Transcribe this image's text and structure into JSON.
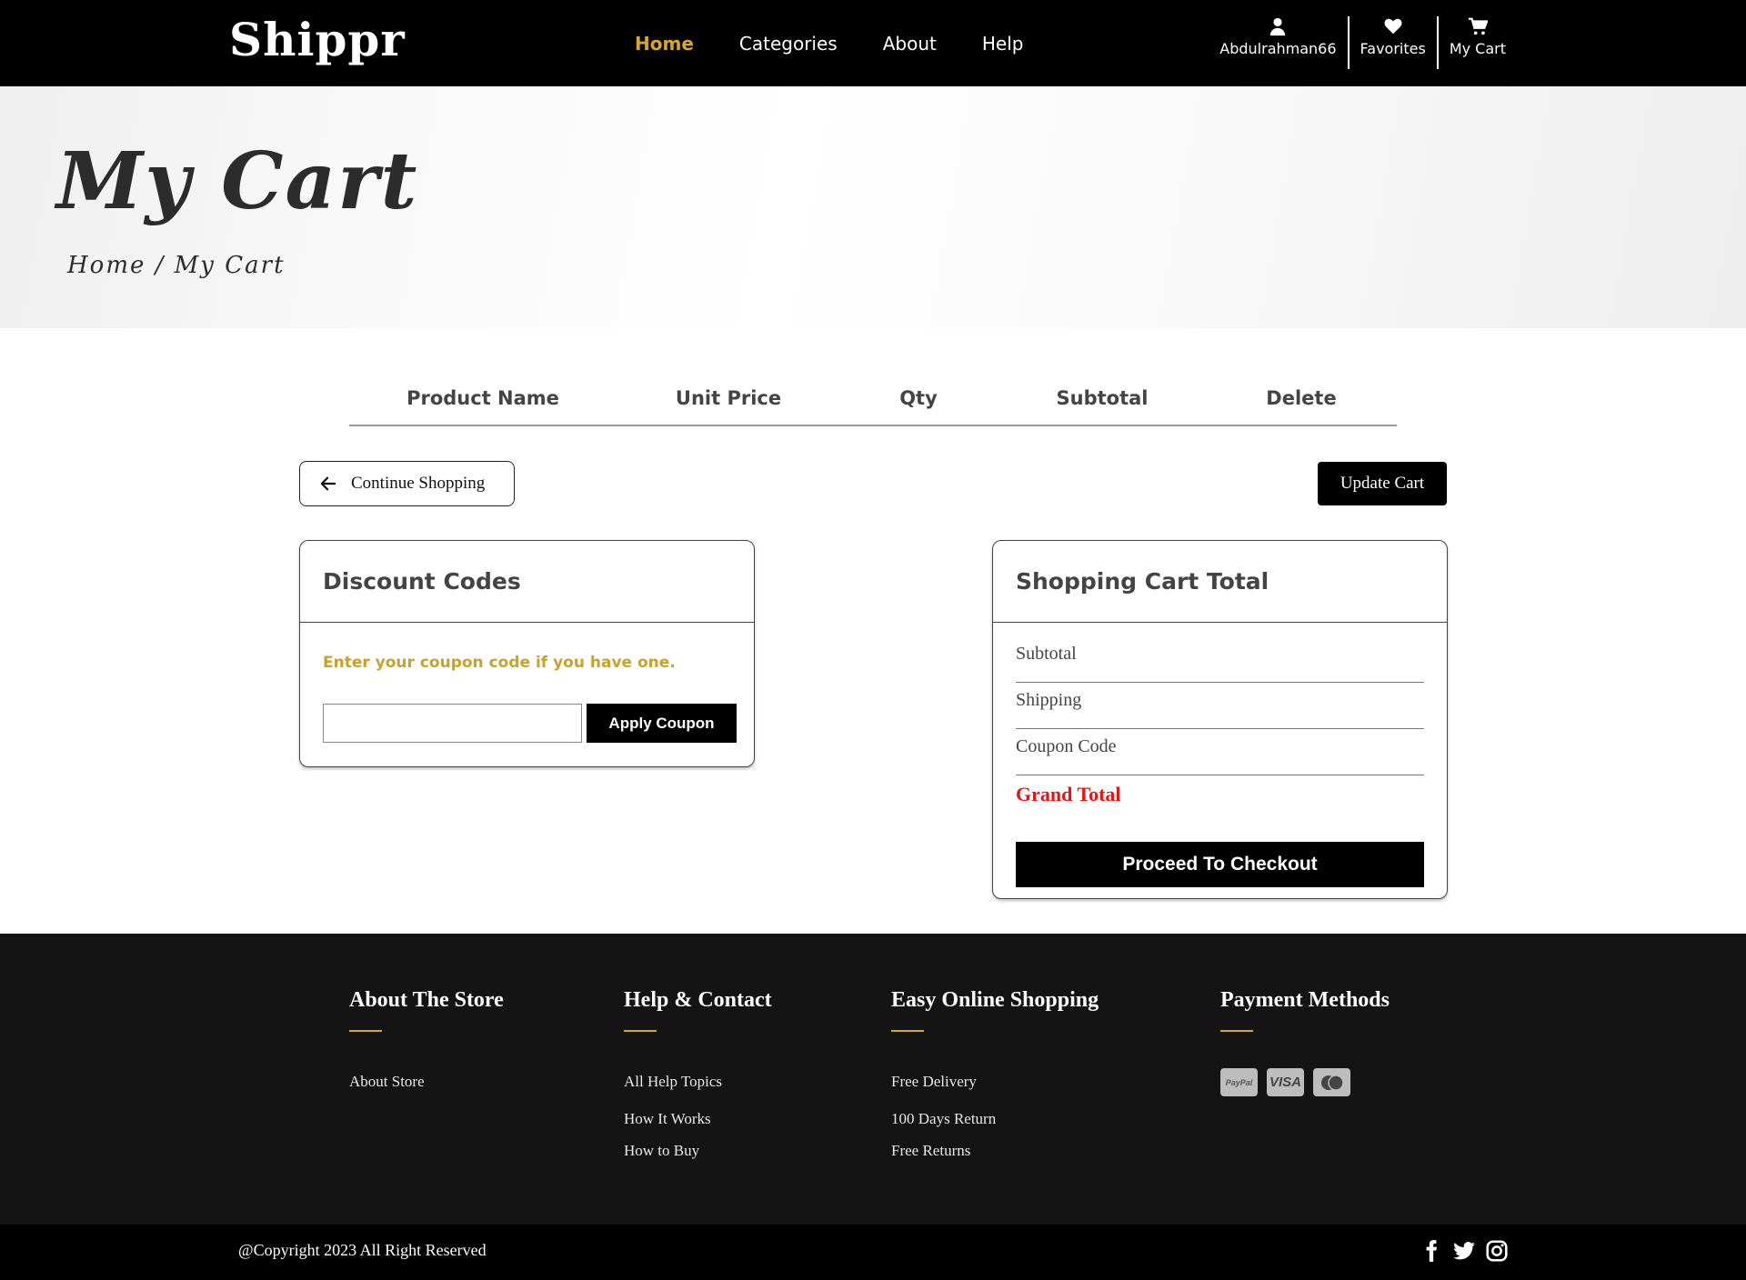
{
  "brand": {
    "name": "Shippr"
  },
  "nav": {
    "links": [
      "Home",
      "Categories",
      "About",
      "Help"
    ],
    "active": "Home",
    "user": "Abdulrahman66",
    "favorites": "Favorites",
    "cart": "My Cart",
    "accent_color": "#d6a823"
  },
  "hero": {
    "title": "My Cart",
    "breadcrumb": {
      "home": "Home",
      "separator": "/",
      "current": "My Cart"
    }
  },
  "cart_table": {
    "columns": [
      "Product Name",
      "Unit Price",
      "Qty",
      "Subtotal",
      "Delete"
    ],
    "rows": []
  },
  "actions": {
    "continue_shopping": "Continue Shopping",
    "update_cart": "Update Cart"
  },
  "discount": {
    "title": "Discount Codes",
    "hint": "Enter your coupon code if you have one.",
    "input_value": "",
    "input_placeholder": "",
    "apply_label": "Apply Coupon"
  },
  "totals": {
    "title": "Shopping Cart Total",
    "rows": [
      "Subtotal",
      "Shipping",
      "Coupon Code"
    ],
    "grand_total_label": "Grand Total",
    "grand_total_color": "#ee1111",
    "checkout_label": "Proceed To Checkout"
  },
  "footer": {
    "columns": [
      {
        "title": "About The Store",
        "links": [
          "About Store"
        ]
      },
      {
        "title": "Help & Contact",
        "links": [
          "All Help Topics",
          "How It Works",
          "How to Buy"
        ]
      },
      {
        "title": "Easy Online Shopping",
        "links": [
          "Free Delivery",
          "100 Days Return",
          "Free Returns"
        ]
      },
      {
        "title": "Payment Methods",
        "payment_icons": [
          "paypal-icon",
          "visa-icon",
          "mastercard-icon"
        ]
      }
    ],
    "payment_labels": {
      "paypal": "PayPal",
      "visa": "VISA"
    },
    "copyright": "@Copyright 2023 All Right Reserved",
    "social_icons": [
      "facebook-icon",
      "twitter-icon",
      "instagram-icon"
    ]
  }
}
